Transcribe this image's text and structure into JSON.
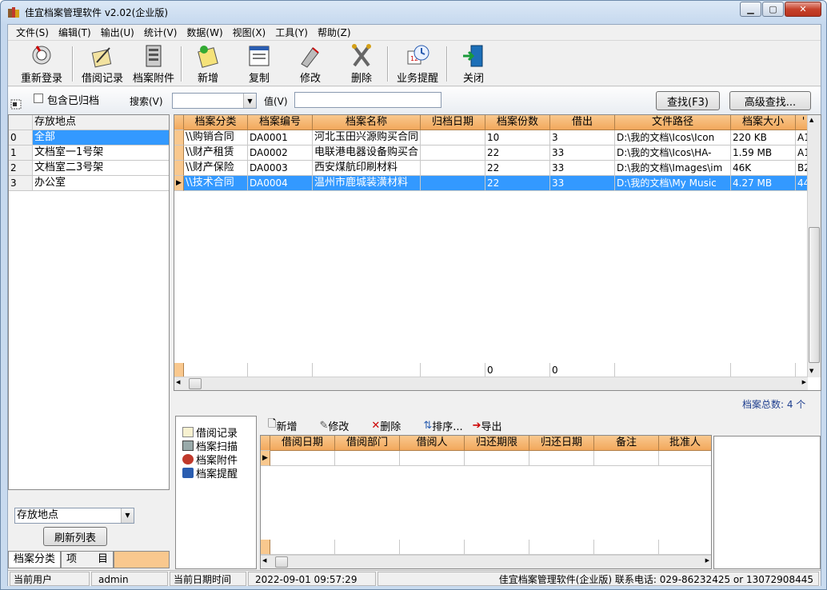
{
  "window": {
    "title": "佳宜档案管理软件 v2.02(企业版)",
    "min": "▁",
    "max": "▢",
    "close": "✕"
  },
  "menu": [
    "文件(S)",
    "编辑(T)",
    "输出(U)",
    "统计(V)",
    "数据(W)",
    "视图(X)",
    "工具(Y)",
    "帮助(Z)"
  ],
  "toolbar": [
    {
      "label": "重新登录",
      "icon": "login-icon"
    },
    {
      "label": "借阅记录",
      "icon": "borrow-icon"
    },
    {
      "label": "档案附件",
      "icon": "attachment-icon"
    },
    {
      "label": "新增",
      "icon": "add-icon"
    },
    {
      "label": "复制",
      "icon": "copy-icon"
    },
    {
      "label": "修改",
      "icon": "edit-icon"
    },
    {
      "label": "删除",
      "icon": "delete-icon"
    },
    {
      "label": "业务提醒",
      "icon": "reminder-icon"
    },
    {
      "label": "关闭",
      "icon": "close-door-icon"
    }
  ],
  "search": {
    "include_archived": "包含已归档",
    "search_label": "搜索(V)",
    "value_label": "值(V)",
    "find_button": "查找(F3)",
    "advanced_button": "高级查找..."
  },
  "left": {
    "header": "存放地点",
    "rows": [
      {
        "idx": "0",
        "name": "全部"
      },
      {
        "idx": "1",
        "name": "文档室一1号架"
      },
      {
        "idx": "2",
        "name": "文档室二3号架"
      },
      {
        "idx": "3",
        "name": "办公室"
      }
    ],
    "combo": "存放地点",
    "refresh": "刷新列表",
    "tab1": "档案分类",
    "tab2": "项　　目"
  },
  "grid": {
    "columns": [
      "档案分类",
      "档案编号",
      "档案名称",
      "归档日期",
      "档案份数",
      "借出",
      "文件路径",
      "档案大小",
      "'"
    ],
    "rows": [
      [
        "\\\\购销合同",
        "DA0001",
        "河北玉田兴源购买合同",
        "",
        "10",
        "3",
        "D:\\我的文档\\Icos\\Icon",
        "220 KB",
        "A1"
      ],
      [
        "\\\\财产租赁",
        "DA0002",
        "电联港电器设备购买合",
        "",
        "22",
        "33",
        "D:\\我的文档\\Icos\\HA-",
        "1.59 MB",
        "A1"
      ],
      [
        "\\\\财产保险",
        "DA0003",
        "西安煤航印刷材料",
        "",
        "22",
        "33",
        "D:\\我的文档\\Images\\im",
        "46K",
        "B2"
      ],
      [
        "\\\\技术合同",
        "DA0004",
        "温州市鹿城装潢材料",
        "",
        "22",
        "33",
        "D:\\我的文档\\My Music",
        "4.27 MB",
        "44"
      ]
    ],
    "footer_copies": "0",
    "footer_lent": "0",
    "total": "档案总数: 4 个"
  },
  "lower": {
    "nav": [
      "借阅记录",
      "档案扫描",
      "档案附件",
      "档案提醒"
    ],
    "subtoolbar": [
      "新增",
      "修改",
      "删除",
      "排序...",
      "导出"
    ],
    "columns": [
      "借阅日期",
      "借阅部门",
      "借阅人",
      "归还期限",
      "归还日期",
      "备注",
      "批准人"
    ]
  },
  "status": {
    "user_label": "当前用户",
    "user": "admin",
    "time_label": "当前日期时间",
    "time": "2022-09-01 09:57:29",
    "info": "佳宜档案管理软件(企业版) 联系电话: 029-86232425 or 13072908445"
  }
}
